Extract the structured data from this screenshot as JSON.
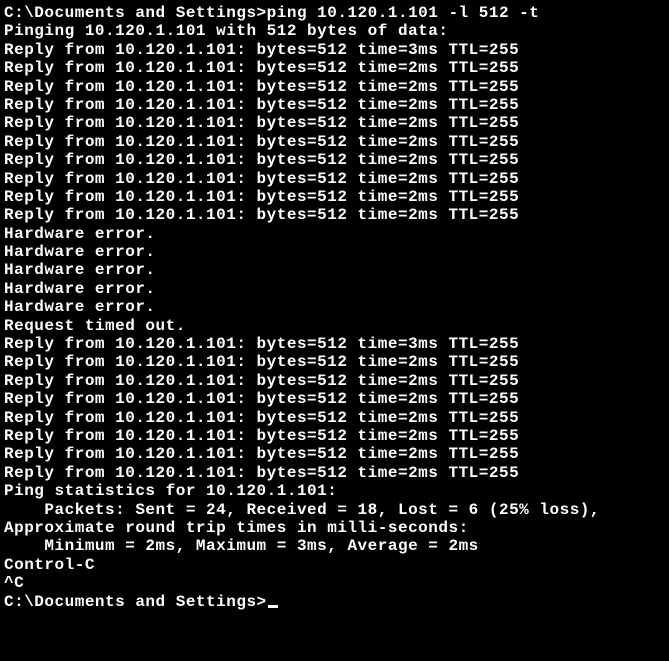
{
  "prompt1": "C:\\Documents and Settings>",
  "command": "ping 10.120.1.101 -l 512 -t",
  "blank": "",
  "header": "Pinging 10.120.1.101 with 512 bytes of data:",
  "replies1": [
    "Reply from 10.120.1.101: bytes=512 time=3ms TTL=255",
    "Reply from 10.120.1.101: bytes=512 time=2ms TTL=255",
    "Reply from 10.120.1.101: bytes=512 time=2ms TTL=255",
    "Reply from 10.120.1.101: bytes=512 time=2ms TTL=255",
    "Reply from 10.120.1.101: bytes=512 time=2ms TTL=255",
    "Reply from 10.120.1.101: bytes=512 time=2ms TTL=255",
    "Reply from 10.120.1.101: bytes=512 time=2ms TTL=255",
    "Reply from 10.120.1.101: bytes=512 time=2ms TTL=255",
    "Reply from 10.120.1.101: bytes=512 time=2ms TTL=255",
    "Reply from 10.120.1.101: bytes=512 time=2ms TTL=255"
  ],
  "errors": [
    "Hardware error.",
    "Hardware error.",
    "Hardware error.",
    "Hardware error.",
    "Hardware error.",
    "Request timed out."
  ],
  "replies2": [
    "Reply from 10.120.1.101: bytes=512 time=3ms TTL=255",
    "Reply from 10.120.1.101: bytes=512 time=2ms TTL=255",
    "Reply from 10.120.1.101: bytes=512 time=2ms TTL=255",
    "Reply from 10.120.1.101: bytes=512 time=2ms TTL=255",
    "Reply from 10.120.1.101: bytes=512 time=2ms TTL=255",
    "Reply from 10.120.1.101: bytes=512 time=2ms TTL=255",
    "Reply from 10.120.1.101: bytes=512 time=2ms TTL=255",
    "Reply from 10.120.1.101: bytes=512 time=2ms TTL=255"
  ],
  "stats": {
    "header": "Ping statistics for 10.120.1.101:",
    "packets": "    Packets: Sent = 24, Received = 18, Lost = 6 (25% loss),",
    "rtt_header": "Approximate round trip times in milli-seconds:",
    "rtt": "    Minimum = 2ms, Maximum = 3ms, Average = 2ms"
  },
  "interrupt": {
    "label": "Control-C",
    "caret": "^C"
  },
  "prompt2": "C:\\Documents and Settings>"
}
